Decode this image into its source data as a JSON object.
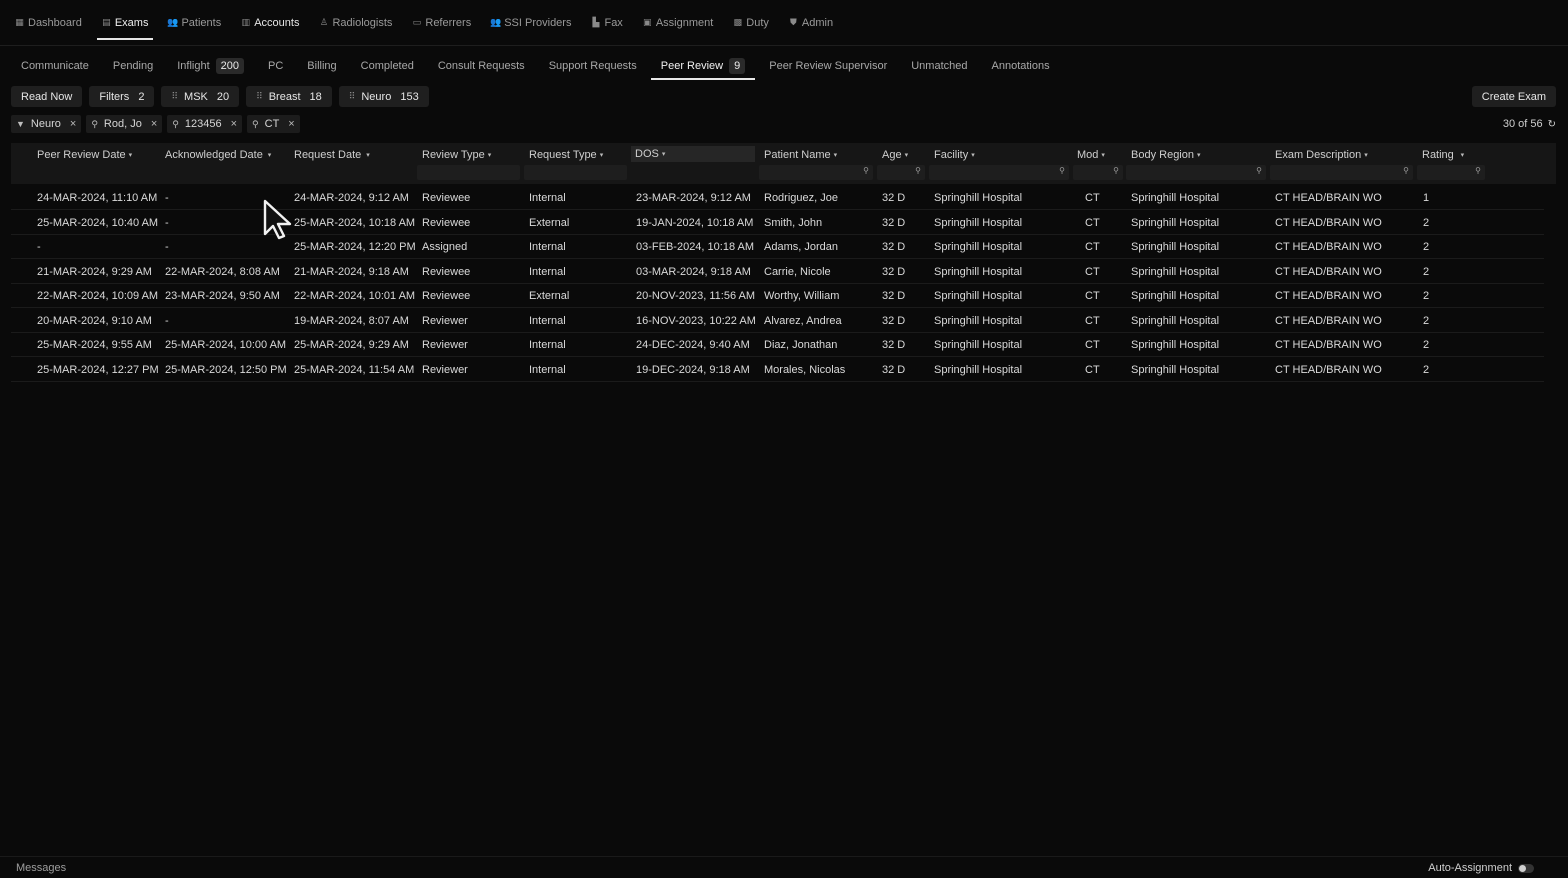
{
  "nav": [
    {
      "label": "Dashboard",
      "icon": "grid-icon",
      "glyph": "▦"
    },
    {
      "label": "Exams",
      "icon": "list-icon",
      "glyph": "▤"
    },
    {
      "label": "Patients",
      "icon": "users-icon",
      "glyph": "👥"
    },
    {
      "label": "Accounts",
      "icon": "building-icon",
      "glyph": "▥"
    },
    {
      "label": "Radiologists",
      "icon": "person-icon",
      "glyph": "♙"
    },
    {
      "label": "Referrers",
      "icon": "id-card-icon",
      "glyph": "▭"
    },
    {
      "label": "SSI Providers",
      "icon": "group-icon",
      "glyph": "👥"
    },
    {
      "label": "Fax",
      "icon": "fax-icon",
      "glyph": "▙"
    },
    {
      "label": "Assignment",
      "icon": "clipboard-icon",
      "glyph": "▣"
    },
    {
      "label": "Duty",
      "icon": "briefcase-icon",
      "glyph": "▩"
    },
    {
      "label": "Admin",
      "icon": "shield-icon",
      "glyph": "⛊"
    }
  ],
  "subtabs": [
    {
      "label": "Communicate"
    },
    {
      "label": "Pending"
    },
    {
      "label": "Inflight",
      "badge": "200"
    },
    {
      "label": "PC"
    },
    {
      "label": "Billing"
    },
    {
      "label": "Completed"
    },
    {
      "label": "Consult Requests"
    },
    {
      "label": "Support Requests"
    },
    {
      "label": "Peer Review",
      "badge": "9"
    },
    {
      "label": "Peer Review Supervisor"
    },
    {
      "label": "Unmatched"
    },
    {
      "label": "Annotations"
    }
  ],
  "quick": {
    "read_now": "Read Now",
    "filters": "Filters",
    "filters_count": "2",
    "msk": "MSK",
    "msk_count": "20",
    "breast": "Breast",
    "breast_count": "18",
    "neuro": "Neuro",
    "neuro_count": "153",
    "create": "Create Exam"
  },
  "chips": [
    {
      "label": "Neuro",
      "icon": "filter-icon",
      "glyph": "⏷"
    },
    {
      "label": "Rod, Jo",
      "icon": "search-icon",
      "glyph": "⌕"
    },
    {
      "label": "123456",
      "icon": "search-icon",
      "glyph": "⌕"
    },
    {
      "label": "CT",
      "icon": "search-icon",
      "glyph": "⌕"
    }
  ],
  "count_text": "30 of 56",
  "columns": [
    {
      "label": "Peer Review Date"
    },
    {
      "label": "Acknowledged Date"
    },
    {
      "label": "Request Date"
    },
    {
      "label": "Review Type"
    },
    {
      "label": "Request Type"
    },
    {
      "label": "DOS"
    },
    {
      "label": "Patient Name"
    },
    {
      "label": "Age"
    },
    {
      "label": "Facility"
    },
    {
      "label": "Mod"
    },
    {
      "label": "Body Region"
    },
    {
      "label": "Exam Description"
    },
    {
      "label": "Rating"
    }
  ],
  "rows": [
    [
      "24-MAR-2024, 11:10 AM",
      "-",
      "24-MAR-2024, 9:12 AM",
      "Reviewee",
      "Internal",
      "23-MAR-2024, 9:12 AM",
      "Rodriguez, Joe",
      "32 D",
      "Springhill Hospital",
      "CT",
      "Springhill Hospital",
      "CT HEAD/BRAIN WO",
      "1"
    ],
    [
      "25-MAR-2024, 10:40 AM",
      "-",
      "25-MAR-2024, 10:18 AM",
      "Reviewee",
      "External",
      "19-JAN-2024, 10:18 AM",
      "Smith, John",
      "32 D",
      "Springhill Hospital",
      "CT",
      "Springhill Hospital",
      "CT HEAD/BRAIN WO",
      "2"
    ],
    [
      "-",
      "-",
      "25-MAR-2024, 12:20 PM",
      "Assigned",
      "Internal",
      "03-FEB-2024, 10:18 AM",
      "Adams, Jordan",
      "32 D",
      "Springhill Hospital",
      "CT",
      "Springhill Hospital",
      "CT HEAD/BRAIN WO",
      "2"
    ],
    [
      "21-MAR-2024, 9:29 AM",
      "22-MAR-2024, 8:08 AM",
      "21-MAR-2024, 9:18 AM",
      "Reviewee",
      "Internal",
      "03-MAR-2024, 9:18 AM",
      "Carrie, Nicole",
      "32 D",
      "Springhill Hospital",
      "CT",
      "Springhill Hospital",
      "CT HEAD/BRAIN WO",
      "2"
    ],
    [
      "22-MAR-2024, 10:09 AM",
      "23-MAR-2024, 9:50 AM",
      "22-MAR-2024, 10:01 AM",
      "Reviewee",
      "External",
      "20-NOV-2023, 11:56 AM",
      "Worthy, William",
      "32 D",
      "Springhill Hospital",
      "CT",
      "Springhill Hospital",
      "CT HEAD/BRAIN WO",
      "2"
    ],
    [
      "20-MAR-2024, 9:10 AM",
      "-",
      "19-MAR-2024, 8:07 AM",
      "Reviewer",
      "Internal",
      "16-NOV-2023, 10:22 AM",
      "Alvarez, Andrea",
      "32 D",
      "Springhill Hospital",
      "CT",
      "Springhill Hospital",
      "CT HEAD/BRAIN WO",
      "2"
    ],
    [
      "25-MAR-2024, 9:55 AM",
      "25-MAR-2024, 10:00 AM",
      "25-MAR-2024, 9:29 AM",
      "Reviewer",
      "Internal",
      "24-DEC-2024, 9:40 AM",
      "Diaz, Jonathan",
      "32 D",
      "Springhill Hospital",
      "CT",
      "Springhill Hospital",
      "CT HEAD/BRAIN WO",
      "2"
    ],
    [
      "25-MAR-2024, 12:27 PM",
      "25-MAR-2024, 12:50 PM",
      "25-MAR-2024, 11:54 AM",
      "Reviewer",
      "Internal",
      "19-DEC-2024, 9:18 AM",
      "Morales, Nicolas",
      "32 D",
      "Springhill Hospital",
      "CT",
      "Springhill Hospital",
      "CT HEAD/BRAIN WO",
      "2"
    ]
  ],
  "footer": {
    "messages": "Messages",
    "auto_assignment": "Auto-Assignment"
  }
}
